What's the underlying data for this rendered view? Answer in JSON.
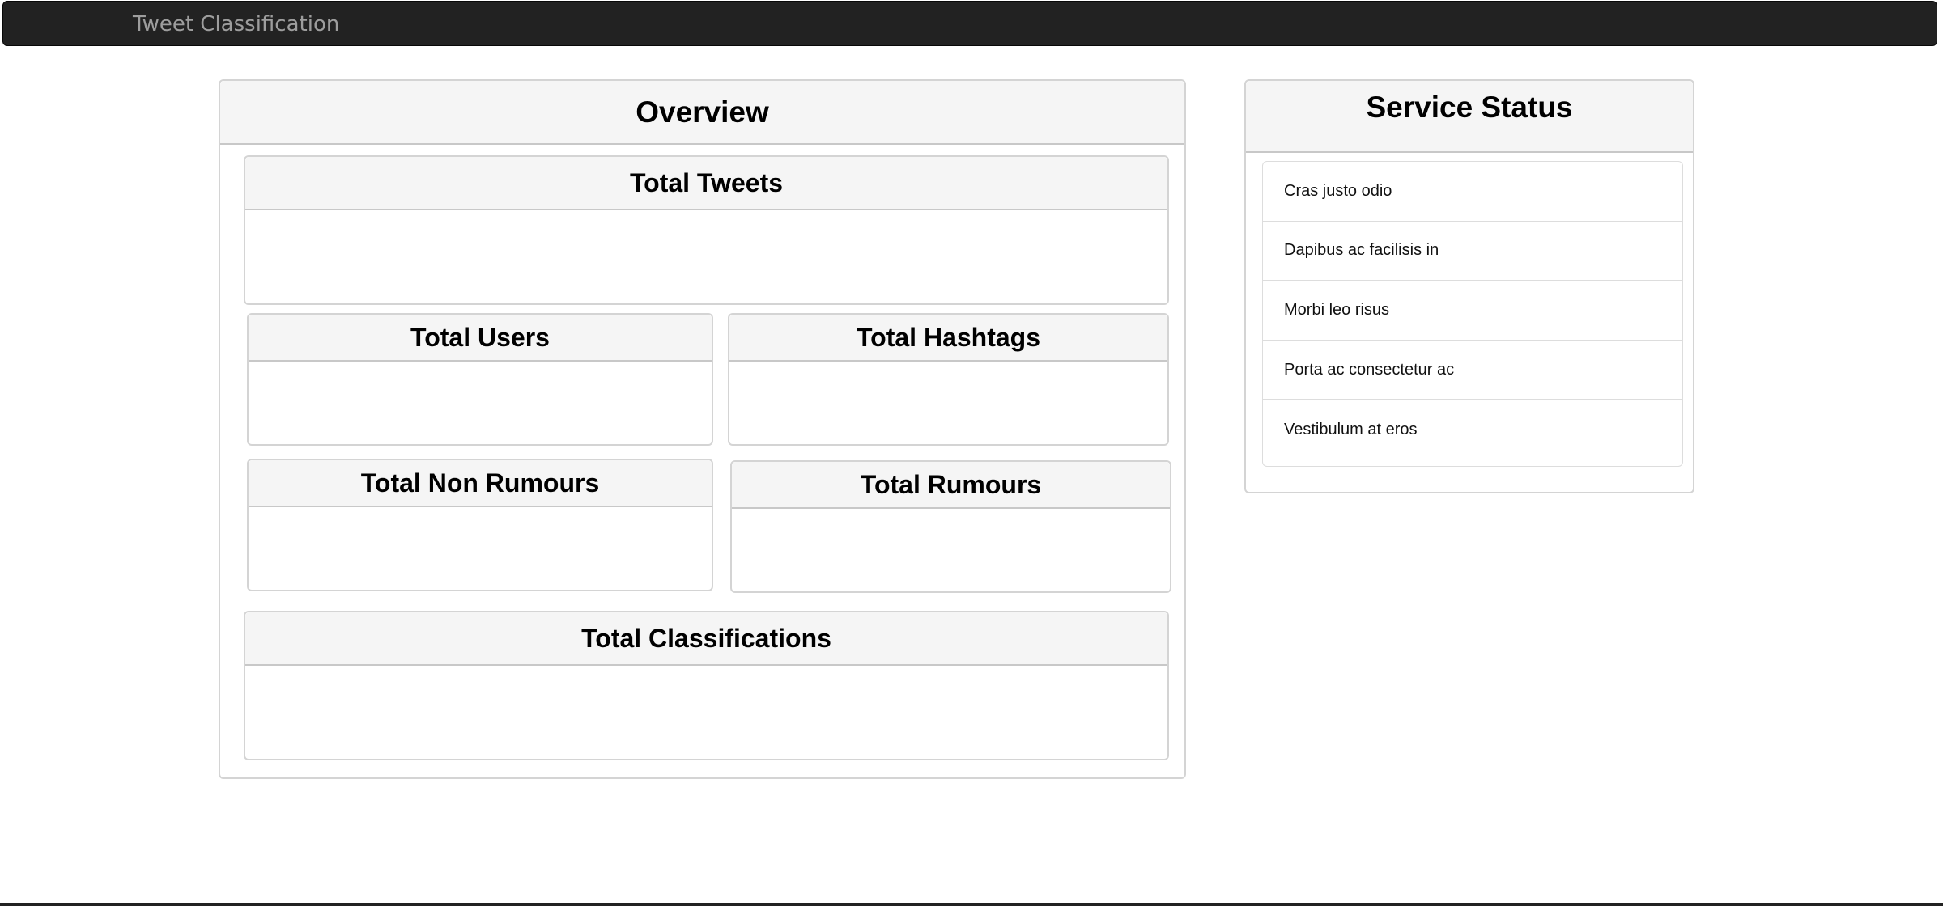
{
  "navbar": {
    "brand": "Tweet Classification"
  },
  "overview": {
    "title": "Overview",
    "cards": {
      "total_tweets": "Total Tweets",
      "total_users": "Total Users",
      "total_hashtags": "Total Hashtags",
      "total_non_rumours": "Total Non Rumours",
      "total_rumours": "Total Rumours",
      "total_classifications": "Total Classifications"
    }
  },
  "service_status": {
    "title": "Service Status",
    "items": [
      "Cras justo odio",
      "Dapibus ac facilisis in",
      "Morbi leo risus",
      "Porta ac consectetur ac",
      "Vestibulum at eros"
    ]
  },
  "colors": {
    "navbar_bg": "#222222",
    "brand_text": "#9d9d9d",
    "panel_heading_bg": "#f5f5f5",
    "panel_border": "#d4d4d4"
  }
}
